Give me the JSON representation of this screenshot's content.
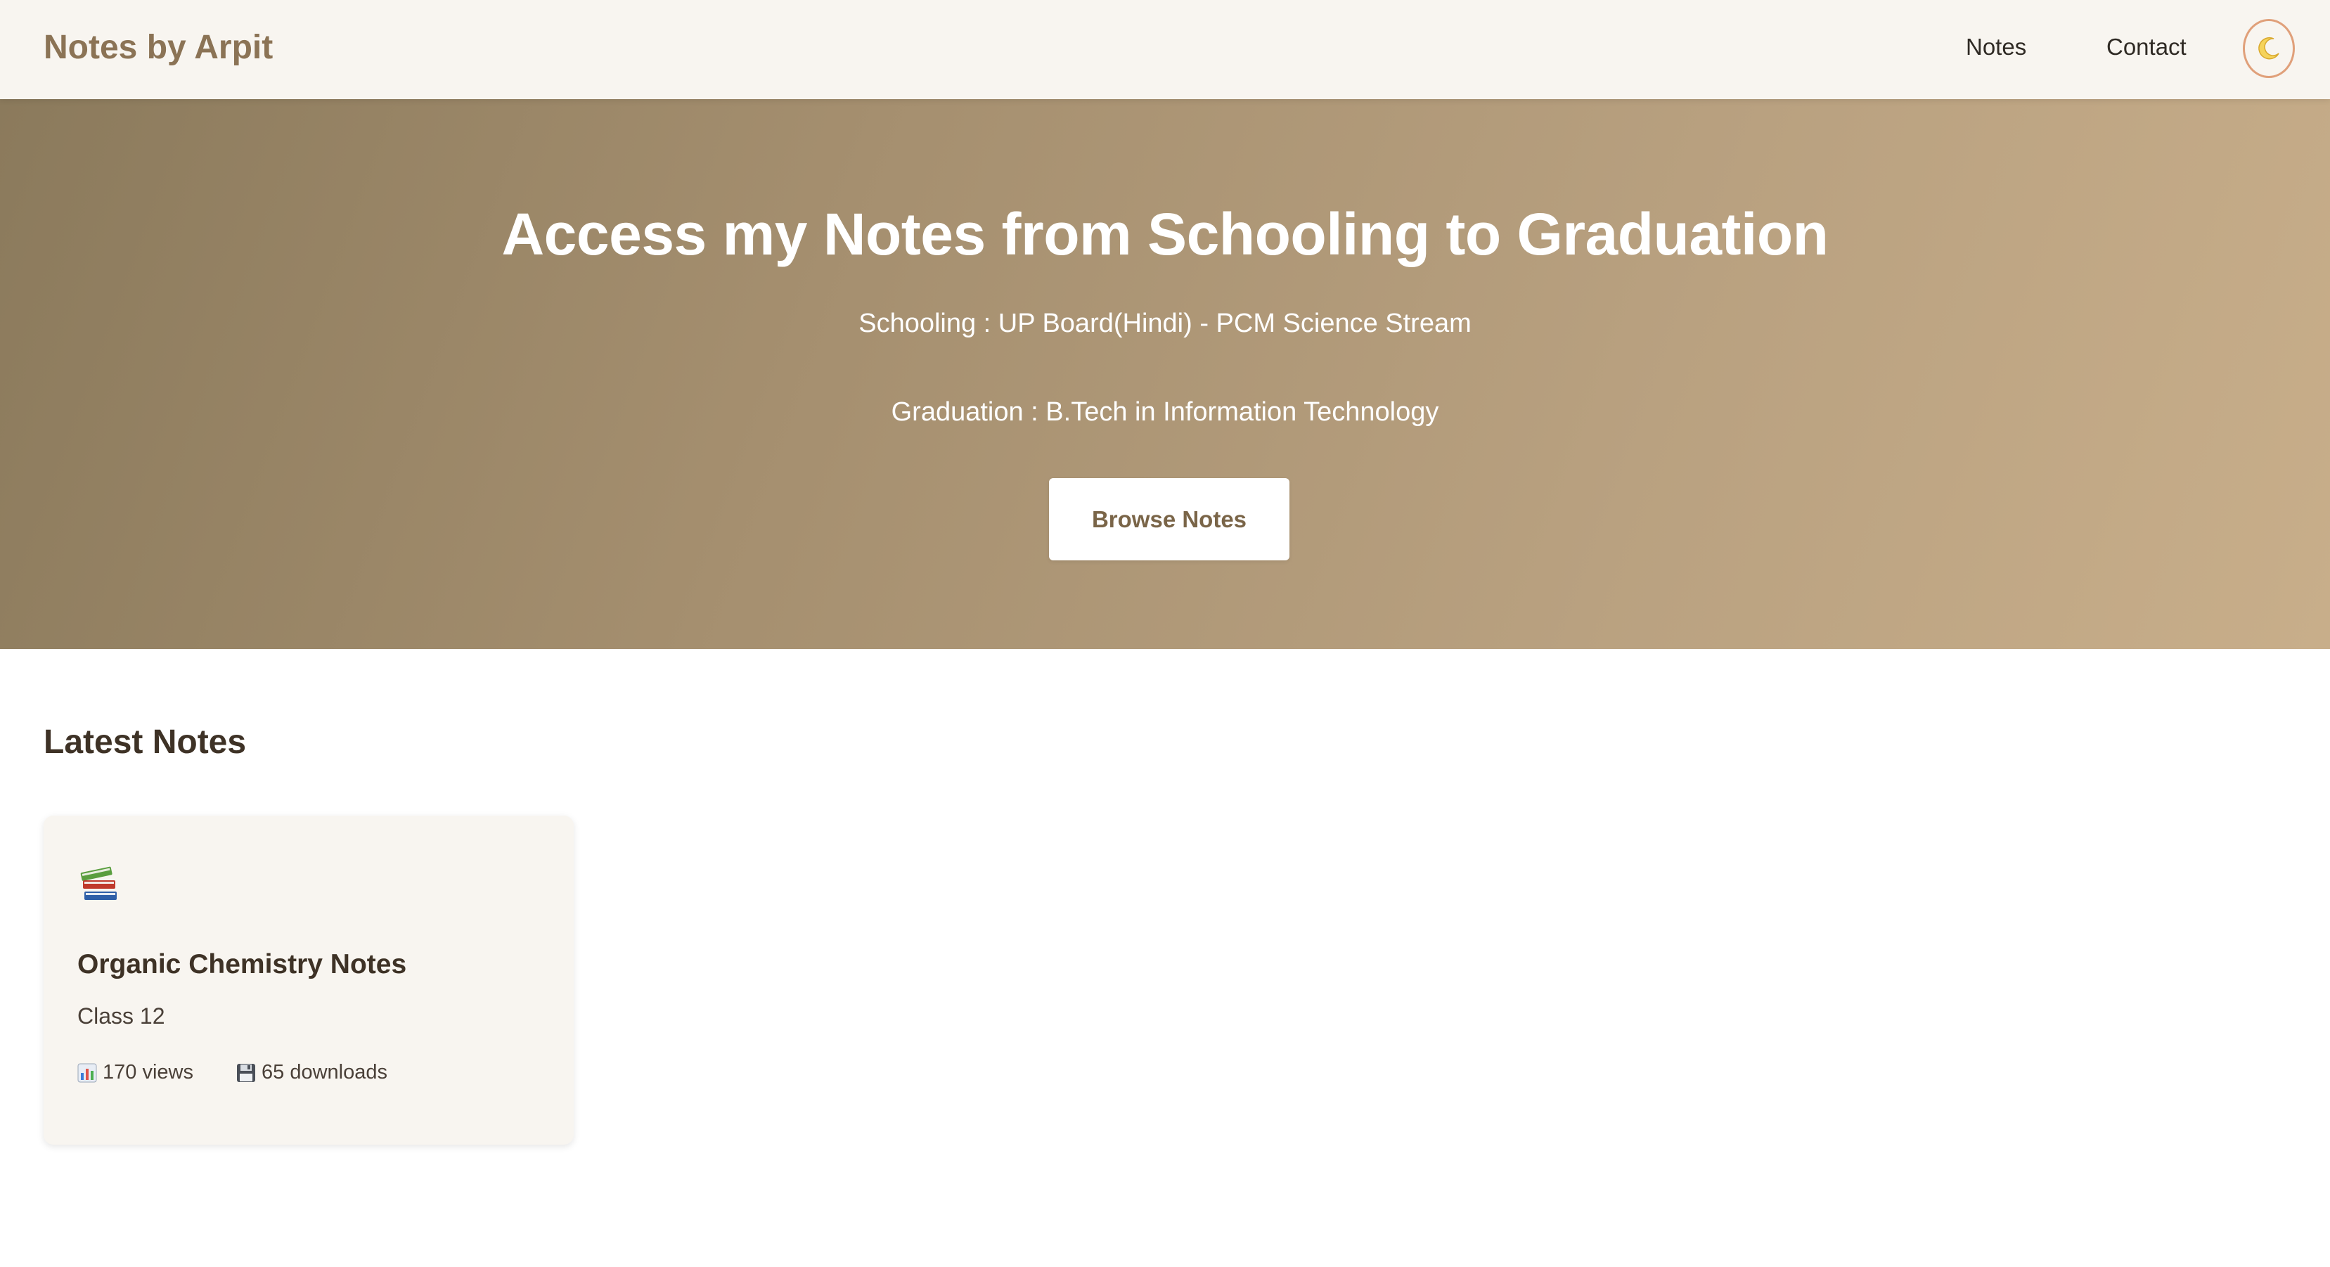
{
  "header": {
    "brand": "Notes by Arpit",
    "nav": [
      {
        "label": "Notes"
      },
      {
        "label": "Contact"
      }
    ],
    "theme_toggle_icon": "moon-icon"
  },
  "hero": {
    "title": "Access my Notes from Schooling to Graduation",
    "schooling": "Schooling : UP Board(Hindi) - PCM Science Stream",
    "graduation": "Graduation : B.Tech in Information Technology",
    "button_label": "Browse Notes"
  },
  "latest": {
    "title": "Latest Notes",
    "cards": [
      {
        "icon": "books-icon",
        "title": "Organic Chemistry Notes",
        "subtitle": "Class 12",
        "views": "170 views",
        "views_icon": "bar-chart-icon",
        "downloads": "65 downloads",
        "downloads_icon": "floppy-disk-icon"
      }
    ]
  },
  "colors": {
    "brand": "#8b7355",
    "header_bg": "#f8f5f0",
    "hero_start": "#8b7a5c",
    "hero_end": "#c8ae8a",
    "card_bg": "#f8f5f0",
    "toggle_border": "#e0a07a"
  }
}
